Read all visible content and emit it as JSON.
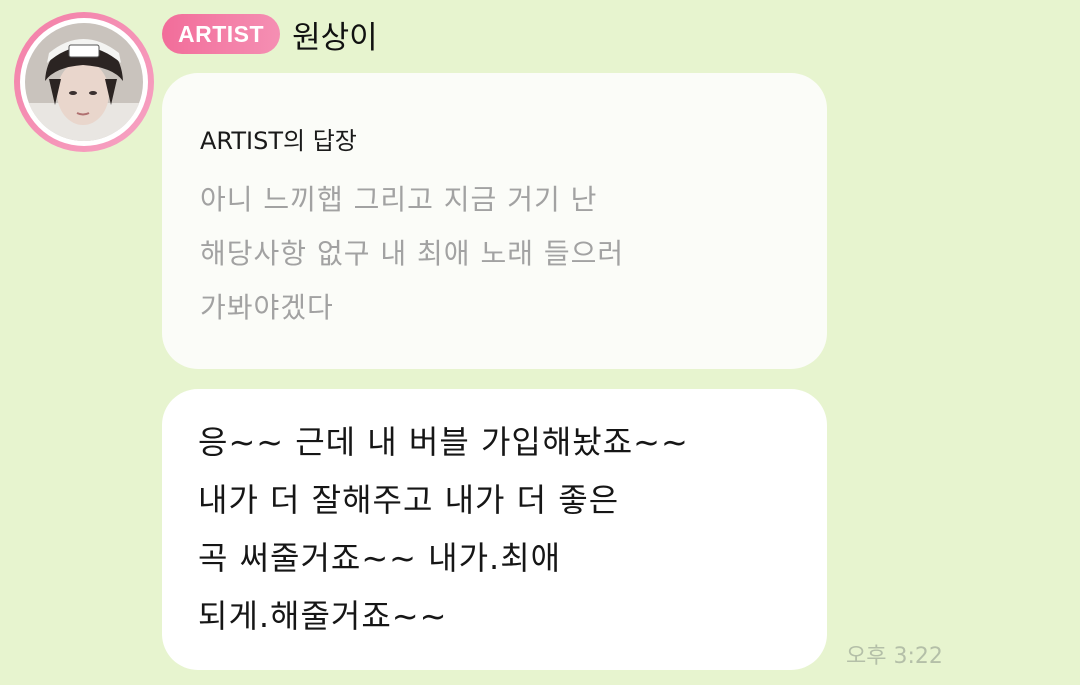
{
  "header": {
    "badge": "ARTIST",
    "name": "원상이"
  },
  "reply": {
    "title": "ARTIST의 답장",
    "lines": [
      "아니 느끼햅 그리고 지금 거기 난",
      "해당사항 없구 내 최애 노래 들으러",
      "가봐야겠다"
    ]
  },
  "message": {
    "lines": [
      "응~~ 근데 내 버블 가입해놨죠~~",
      "내가 더 잘해주고 내가 더 좋은",
      "곡 써줄거죠~~ 내가.최애",
      "되게.해줄거죠~~"
    ],
    "time": "오후 3:22"
  },
  "colors": {
    "background": "#e7f4cf",
    "badge": "#f26d9a",
    "avatar_ring": "#f37fa7"
  }
}
